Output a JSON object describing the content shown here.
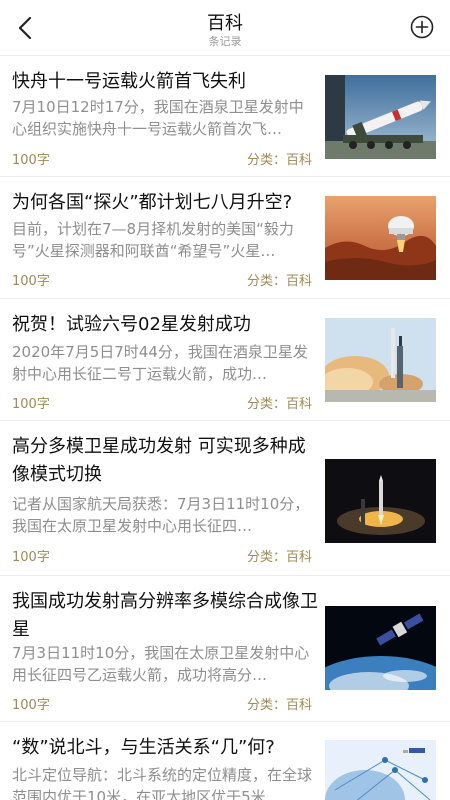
{
  "header": {
    "title": "百科",
    "subtitle": "条记录",
    "back_icon": "chevron-left-icon",
    "add_icon": "plus-circle-icon"
  },
  "items": [
    {
      "title": "快舟十一号运载火箭首飞失利",
      "summary": "7月10日12时17分，我国在酒泉卫星发射中心组织实施快舟十一号运载火箭首次飞…",
      "words": "100字",
      "category": "分类：百科",
      "image": "rocket-on-launch-vehicle"
    },
    {
      "title": "为何各国“探火”都计划七八月升空?",
      "summary": "目前，计划在7—8月择机发射的美国“毅力号”火星探测器和阿联酋“希望号”火星…",
      "words": "100字",
      "category": "分类：百科",
      "image": "mars-lander"
    },
    {
      "title": "祝贺！试验六号02星发射成功",
      "summary": "2020年7月5日7时44分，我国在酒泉卫星发射中心用长征二号丁运载火箭，成功…",
      "words": "100字",
      "category": "分类：百科",
      "image": "rocket-launch-daylight"
    },
    {
      "title": "高分多模卫星成功发射 可实现多种成像模式切换",
      "summary": "记者从国家航天局获悉：7月3日11时10分，我国在太原卫星发射中心用长征四…",
      "words": "100字",
      "category": "分类：百科",
      "image": "rocket-launch-night"
    },
    {
      "title": "我国成功发射高分辨率多模综合成像卫星",
      "summary": "7月3日11时10分，我国在太原卫星发射中心用长征四号乙运载火箭，成功将高分…",
      "words": "100字",
      "category": "分类：百科",
      "image": "satellite-over-earth"
    },
    {
      "title": "“数”说北斗，与生活关系“几”何?",
      "summary": "北斗定位导航：北斗系统的定位精度，在全球范围内优于10米，在亚太地区优于5米",
      "words": "",
      "category": "",
      "image": "beidou-satellite-network"
    }
  ]
}
